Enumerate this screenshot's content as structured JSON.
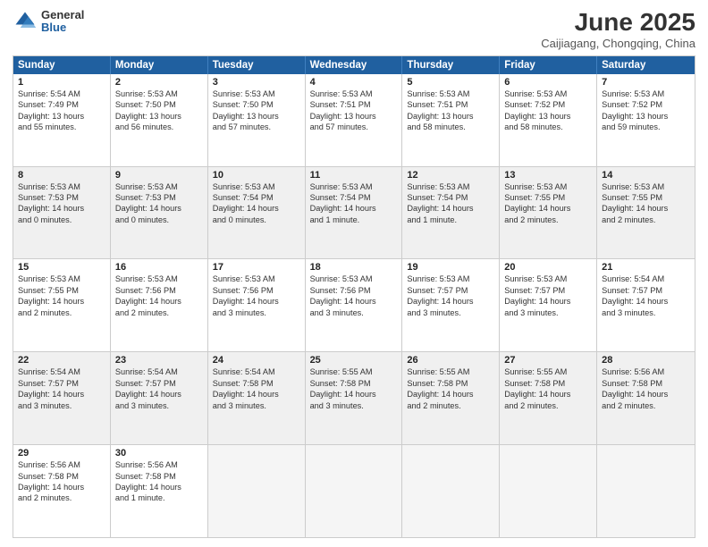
{
  "logo": {
    "general": "General",
    "blue": "Blue"
  },
  "title": {
    "main": "June 2025",
    "sub": "Caijiagang, Chongqing, China"
  },
  "headers": [
    "Sunday",
    "Monday",
    "Tuesday",
    "Wednesday",
    "Thursday",
    "Friday",
    "Saturday"
  ],
  "rows": [
    [
      {
        "day": "1",
        "lines": [
          "Sunrise: 5:54 AM",
          "Sunset: 7:49 PM",
          "Daylight: 13 hours",
          "and 55 minutes."
        ]
      },
      {
        "day": "2",
        "lines": [
          "Sunrise: 5:53 AM",
          "Sunset: 7:50 PM",
          "Daylight: 13 hours",
          "and 56 minutes."
        ]
      },
      {
        "day": "3",
        "lines": [
          "Sunrise: 5:53 AM",
          "Sunset: 7:50 PM",
          "Daylight: 13 hours",
          "and 57 minutes."
        ]
      },
      {
        "day": "4",
        "lines": [
          "Sunrise: 5:53 AM",
          "Sunset: 7:51 PM",
          "Daylight: 13 hours",
          "and 57 minutes."
        ]
      },
      {
        "day": "5",
        "lines": [
          "Sunrise: 5:53 AM",
          "Sunset: 7:51 PM",
          "Daylight: 13 hours",
          "and 58 minutes."
        ]
      },
      {
        "day": "6",
        "lines": [
          "Sunrise: 5:53 AM",
          "Sunset: 7:52 PM",
          "Daylight: 13 hours",
          "and 58 minutes."
        ]
      },
      {
        "day": "7",
        "lines": [
          "Sunrise: 5:53 AM",
          "Sunset: 7:52 PM",
          "Daylight: 13 hours",
          "and 59 minutes."
        ]
      }
    ],
    [
      {
        "day": "8",
        "lines": [
          "Sunrise: 5:53 AM",
          "Sunset: 7:53 PM",
          "Daylight: 14 hours",
          "and 0 minutes."
        ]
      },
      {
        "day": "9",
        "lines": [
          "Sunrise: 5:53 AM",
          "Sunset: 7:53 PM",
          "Daylight: 14 hours",
          "and 0 minutes."
        ]
      },
      {
        "day": "10",
        "lines": [
          "Sunrise: 5:53 AM",
          "Sunset: 7:54 PM",
          "Daylight: 14 hours",
          "and 0 minutes."
        ]
      },
      {
        "day": "11",
        "lines": [
          "Sunrise: 5:53 AM",
          "Sunset: 7:54 PM",
          "Daylight: 14 hours",
          "and 1 minute."
        ]
      },
      {
        "day": "12",
        "lines": [
          "Sunrise: 5:53 AM",
          "Sunset: 7:54 PM",
          "Daylight: 14 hours",
          "and 1 minute."
        ]
      },
      {
        "day": "13",
        "lines": [
          "Sunrise: 5:53 AM",
          "Sunset: 7:55 PM",
          "Daylight: 14 hours",
          "and 2 minutes."
        ]
      },
      {
        "day": "14",
        "lines": [
          "Sunrise: 5:53 AM",
          "Sunset: 7:55 PM",
          "Daylight: 14 hours",
          "and 2 minutes."
        ]
      }
    ],
    [
      {
        "day": "15",
        "lines": [
          "Sunrise: 5:53 AM",
          "Sunset: 7:55 PM",
          "Daylight: 14 hours",
          "and 2 minutes."
        ]
      },
      {
        "day": "16",
        "lines": [
          "Sunrise: 5:53 AM",
          "Sunset: 7:56 PM",
          "Daylight: 14 hours",
          "and 2 minutes."
        ]
      },
      {
        "day": "17",
        "lines": [
          "Sunrise: 5:53 AM",
          "Sunset: 7:56 PM",
          "Daylight: 14 hours",
          "and 3 minutes."
        ]
      },
      {
        "day": "18",
        "lines": [
          "Sunrise: 5:53 AM",
          "Sunset: 7:56 PM",
          "Daylight: 14 hours",
          "and 3 minutes."
        ]
      },
      {
        "day": "19",
        "lines": [
          "Sunrise: 5:53 AM",
          "Sunset: 7:57 PM",
          "Daylight: 14 hours",
          "and 3 minutes."
        ]
      },
      {
        "day": "20",
        "lines": [
          "Sunrise: 5:53 AM",
          "Sunset: 7:57 PM",
          "Daylight: 14 hours",
          "and 3 minutes."
        ]
      },
      {
        "day": "21",
        "lines": [
          "Sunrise: 5:54 AM",
          "Sunset: 7:57 PM",
          "Daylight: 14 hours",
          "and 3 minutes."
        ]
      }
    ],
    [
      {
        "day": "22",
        "lines": [
          "Sunrise: 5:54 AM",
          "Sunset: 7:57 PM",
          "Daylight: 14 hours",
          "and 3 minutes."
        ]
      },
      {
        "day": "23",
        "lines": [
          "Sunrise: 5:54 AM",
          "Sunset: 7:57 PM",
          "Daylight: 14 hours",
          "and 3 minutes."
        ]
      },
      {
        "day": "24",
        "lines": [
          "Sunrise: 5:54 AM",
          "Sunset: 7:58 PM",
          "Daylight: 14 hours",
          "and 3 minutes."
        ]
      },
      {
        "day": "25",
        "lines": [
          "Sunrise: 5:55 AM",
          "Sunset: 7:58 PM",
          "Daylight: 14 hours",
          "and 3 minutes."
        ]
      },
      {
        "day": "26",
        "lines": [
          "Sunrise: 5:55 AM",
          "Sunset: 7:58 PM",
          "Daylight: 14 hours",
          "and 2 minutes."
        ]
      },
      {
        "day": "27",
        "lines": [
          "Sunrise: 5:55 AM",
          "Sunset: 7:58 PM",
          "Daylight: 14 hours",
          "and 2 minutes."
        ]
      },
      {
        "day": "28",
        "lines": [
          "Sunrise: 5:56 AM",
          "Sunset: 7:58 PM",
          "Daylight: 14 hours",
          "and 2 minutes."
        ]
      }
    ],
    [
      {
        "day": "29",
        "lines": [
          "Sunrise: 5:56 AM",
          "Sunset: 7:58 PM",
          "Daylight: 14 hours",
          "and 2 minutes."
        ]
      },
      {
        "day": "30",
        "lines": [
          "Sunrise: 5:56 AM",
          "Sunset: 7:58 PM",
          "Daylight: 14 hours",
          "and 1 minute."
        ]
      },
      {
        "day": "",
        "lines": []
      },
      {
        "day": "",
        "lines": []
      },
      {
        "day": "",
        "lines": []
      },
      {
        "day": "",
        "lines": []
      },
      {
        "day": "",
        "lines": []
      }
    ]
  ]
}
